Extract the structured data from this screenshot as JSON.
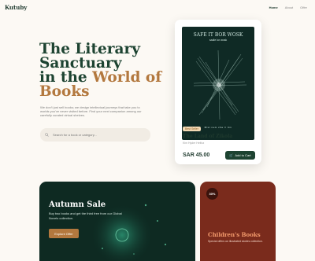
{
  "header": {
    "logo": "Kutuby",
    "nav": [
      "Home",
      "About",
      "Offer"
    ]
  },
  "hero": {
    "title_line1": "The Literary",
    "title_line2": "Sanctuary",
    "title_line3_prefix": "in the ",
    "title_line3_accent": "World of",
    "title_line4_accent": "Books",
    "description": "We don't just sell books; we design intellectual journeys that take you to worlds you've never visited before. Find your next companion among our carefully curated virtual shelves.",
    "search_placeholder": "Search for a book or category..."
  },
  "featured_book": {
    "cover_title": "SAFE IT BOR WOSK",
    "cover_subtitle": "sadie lor wosk",
    "cover_author": "Mist  nem cha lr ttm",
    "genre": "Best Seller",
    "title": "The Land of Zikola",
    "author": "Kim Hyder Helfoz",
    "price": "SAR 45.00",
    "add_to_cart": "Add to Cart"
  },
  "promos": {
    "autumn": {
      "title": "Autumn Sale",
      "description": "Buy two books and get the third free from our Global Novels collection.",
      "button": "Explore Offer"
    },
    "children": {
      "badge": "30%",
      "title": "Children's Books",
      "description": "Special offers on illustrated stories collection."
    }
  },
  "colors": {
    "primary": "#1d4331",
    "accent": "#b3783e",
    "background": "#fcf9f4",
    "autumn_bg": "#0e2a22",
    "children_bg": "#7a2b1c"
  }
}
